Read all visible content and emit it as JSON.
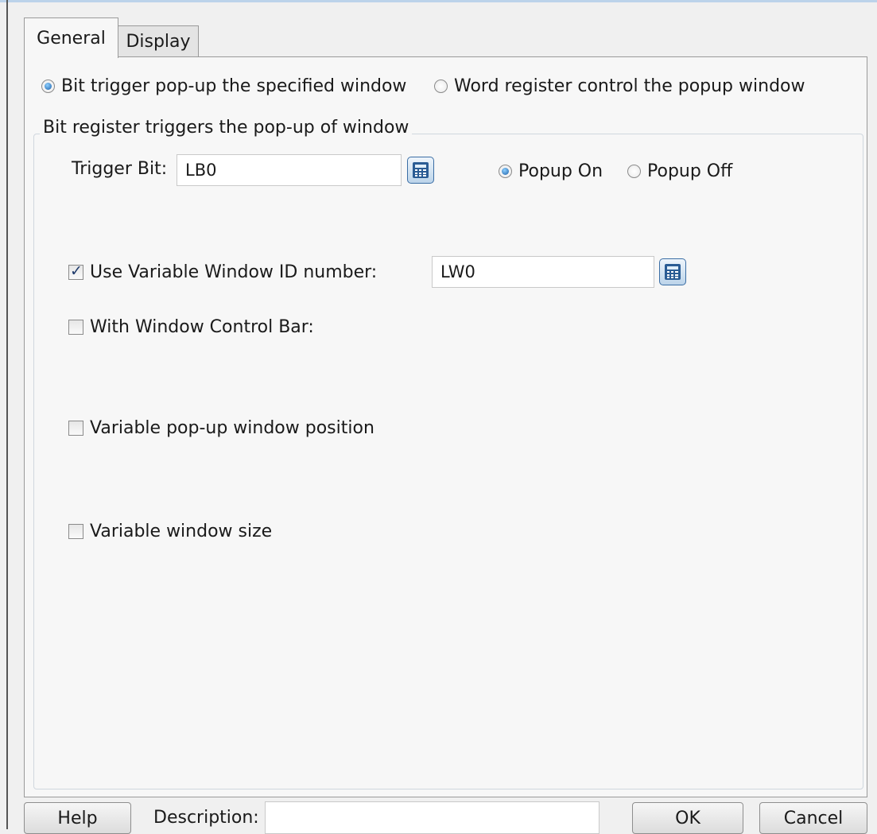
{
  "tabs": [
    {
      "label": "General"
    },
    {
      "label": "Display"
    }
  ],
  "trigger_mode": {
    "options": [
      {
        "label": "Bit trigger pop-up the specified window",
        "selected": true
      },
      {
        "label": "Word register control the popup window",
        "selected": false
      }
    ]
  },
  "group": {
    "title": "Bit register triggers the pop-up of  window",
    "trigger_bit_label": "Trigger Bit:",
    "trigger_bit_value": "LB0",
    "popup_on_label": "Popup On",
    "popup_off_label": "Popup Off",
    "popup_on_selected": true,
    "use_variable_id_label": "Use Variable Window ID number:",
    "use_variable_id_checked": true,
    "variable_id_value": "LW0",
    "control_bar_label": "With Window Control Bar:",
    "control_bar_checked": false,
    "variable_position_label": "Variable pop-up window position",
    "variable_position_checked": false,
    "variable_size_label": "Variable window size",
    "variable_size_checked": false
  },
  "footer": {
    "help_label": "Help",
    "description_label": "Description:",
    "description_value": "",
    "ok_label": "OK",
    "cancel_label": "Cancel"
  },
  "colors": {
    "accent": "#1a5fa8",
    "panel": "#f7f7f7",
    "background": "#f0f0f0"
  }
}
